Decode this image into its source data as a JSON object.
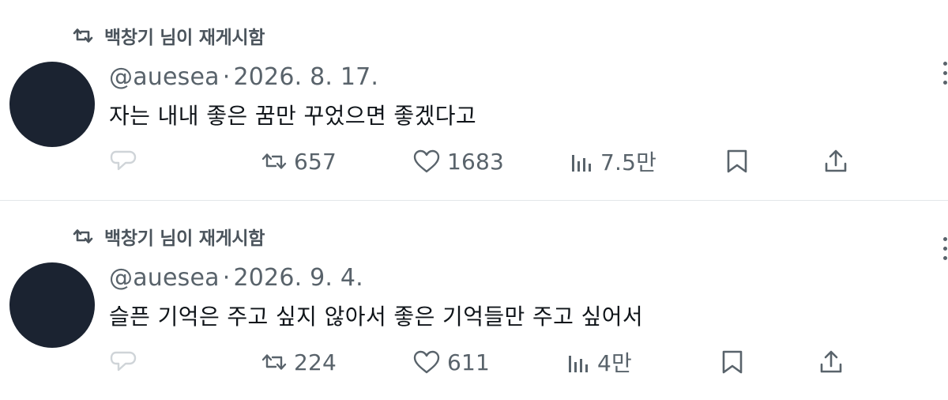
{
  "posts": [
    {
      "repost_label": "백창기 님이 재게시함",
      "handle": "@auesea",
      "separator": "·",
      "date": "2026. 8. 17.",
      "text": "자는 내내 좋은 꿈만 꾸었으면 좋겠다고",
      "reposts": "657",
      "likes": "1683",
      "views": "7.5만"
    },
    {
      "repost_label": "백창기 님이 재게시함",
      "handle": "@auesea",
      "separator": "·",
      "date": "2026. 9. 4.",
      "text": "슬픈 기억은 주고 싶지 않아서 좋은 기억들만 주고 싶어서",
      "reposts": "224",
      "likes": "611",
      "views": "4만"
    }
  ],
  "icons": [
    "repost-icon",
    "reply-icon",
    "like-icon",
    "views-icon",
    "bookmark-icon",
    "share-icon",
    "more-icon"
  ],
  "colors": {
    "text": "#0f1419",
    "muted": "#59636b",
    "avatar": "#1b2331",
    "divider": "#e3e6e9"
  }
}
